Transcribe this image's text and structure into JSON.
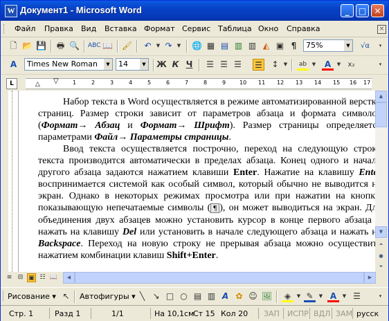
{
  "window": {
    "title": "Документ1 - Microsoft Word",
    "app_icon": "W"
  },
  "menu": [
    "Файл",
    "Правка",
    "Вид",
    "Вставка",
    "Формат",
    "Сервис",
    "Таблица",
    "Окно",
    "Справка"
  ],
  "standard_toolbar": {
    "zoom": "75%"
  },
  "format_toolbar": {
    "font": "Times New Roman",
    "size": "14",
    "bold": "Ж",
    "italic": "К",
    "underline": "Ч",
    "align_justify_active": true
  },
  "ruler": {
    "marks": [
      "1",
      "2",
      "3",
      "4",
      "5",
      "6",
      "7",
      "8",
      "9",
      "10",
      "11",
      "12",
      "13",
      "14",
      "15",
      "16",
      "17"
    ]
  },
  "document": {
    "p1_a": "Набор текста в Word осуществляется в режиме автоматизированной верстки страниц. Размер строки зависит от параметров абзаца и формата символов (",
    "p1_b": "Формат→ Абзац",
    "p1_c": " и ",
    "p1_d": "Формат→ Шрифт",
    "p1_e": "). Размер страницы определяется параметрами ",
    "p1_f": "Файл→ Параметры страницы",
    "p1_g": ".",
    "p2_a": "Ввод текста осуществляется построчно, переход на следующую строку текста производится автоматически в пределах абзаца. Конец одного и начало другого абзаца задаются нажатием клавиши ",
    "p2_b": "Enter",
    "p2_c": ". Нажатие на клавишу ",
    "p2_d": "Enter",
    "p2_e": " воспринимается системой как особый символ, который обычно не выводится на экран. Однако в некоторых режимах просмотра или при нажатии на кнопку, показывающую непечатаемые символы (",
    "p2_f": "¶",
    "p2_g": "), он может выводиться на экран. Для объединения двух абзацев можно установить курсор в конце первого абзаца и нажать на клавишу ",
    "p2_h": "Del",
    "p2_i": " или установить в начале следующего абзаца и нажать на ",
    "p2_j": "Backspace",
    "p2_k": ". Переход на новую строку не прерывая абзаца можно осуществить нажатием комбинации клавиш ",
    "p2_l": "Shift+Enter",
    "p2_m": "."
  },
  "drawing_toolbar": {
    "draw": "Рисование",
    "autoshapes": "Автофигуры"
  },
  "status": {
    "page": "Стр. 1",
    "section": "Разд 1",
    "pages": "1/1",
    "at": "На 10,1см",
    "line": "Ст 15",
    "col": "Кол 20",
    "rec": "ЗАП",
    "trk": "ИСПР",
    "ext": "ВДЛ",
    "ovr": "ЗАМ",
    "lang": "русск"
  },
  "colors": {
    "title_bar": "#0842c5",
    "highlight": "#ffff00",
    "font_color": "#ff0000"
  }
}
